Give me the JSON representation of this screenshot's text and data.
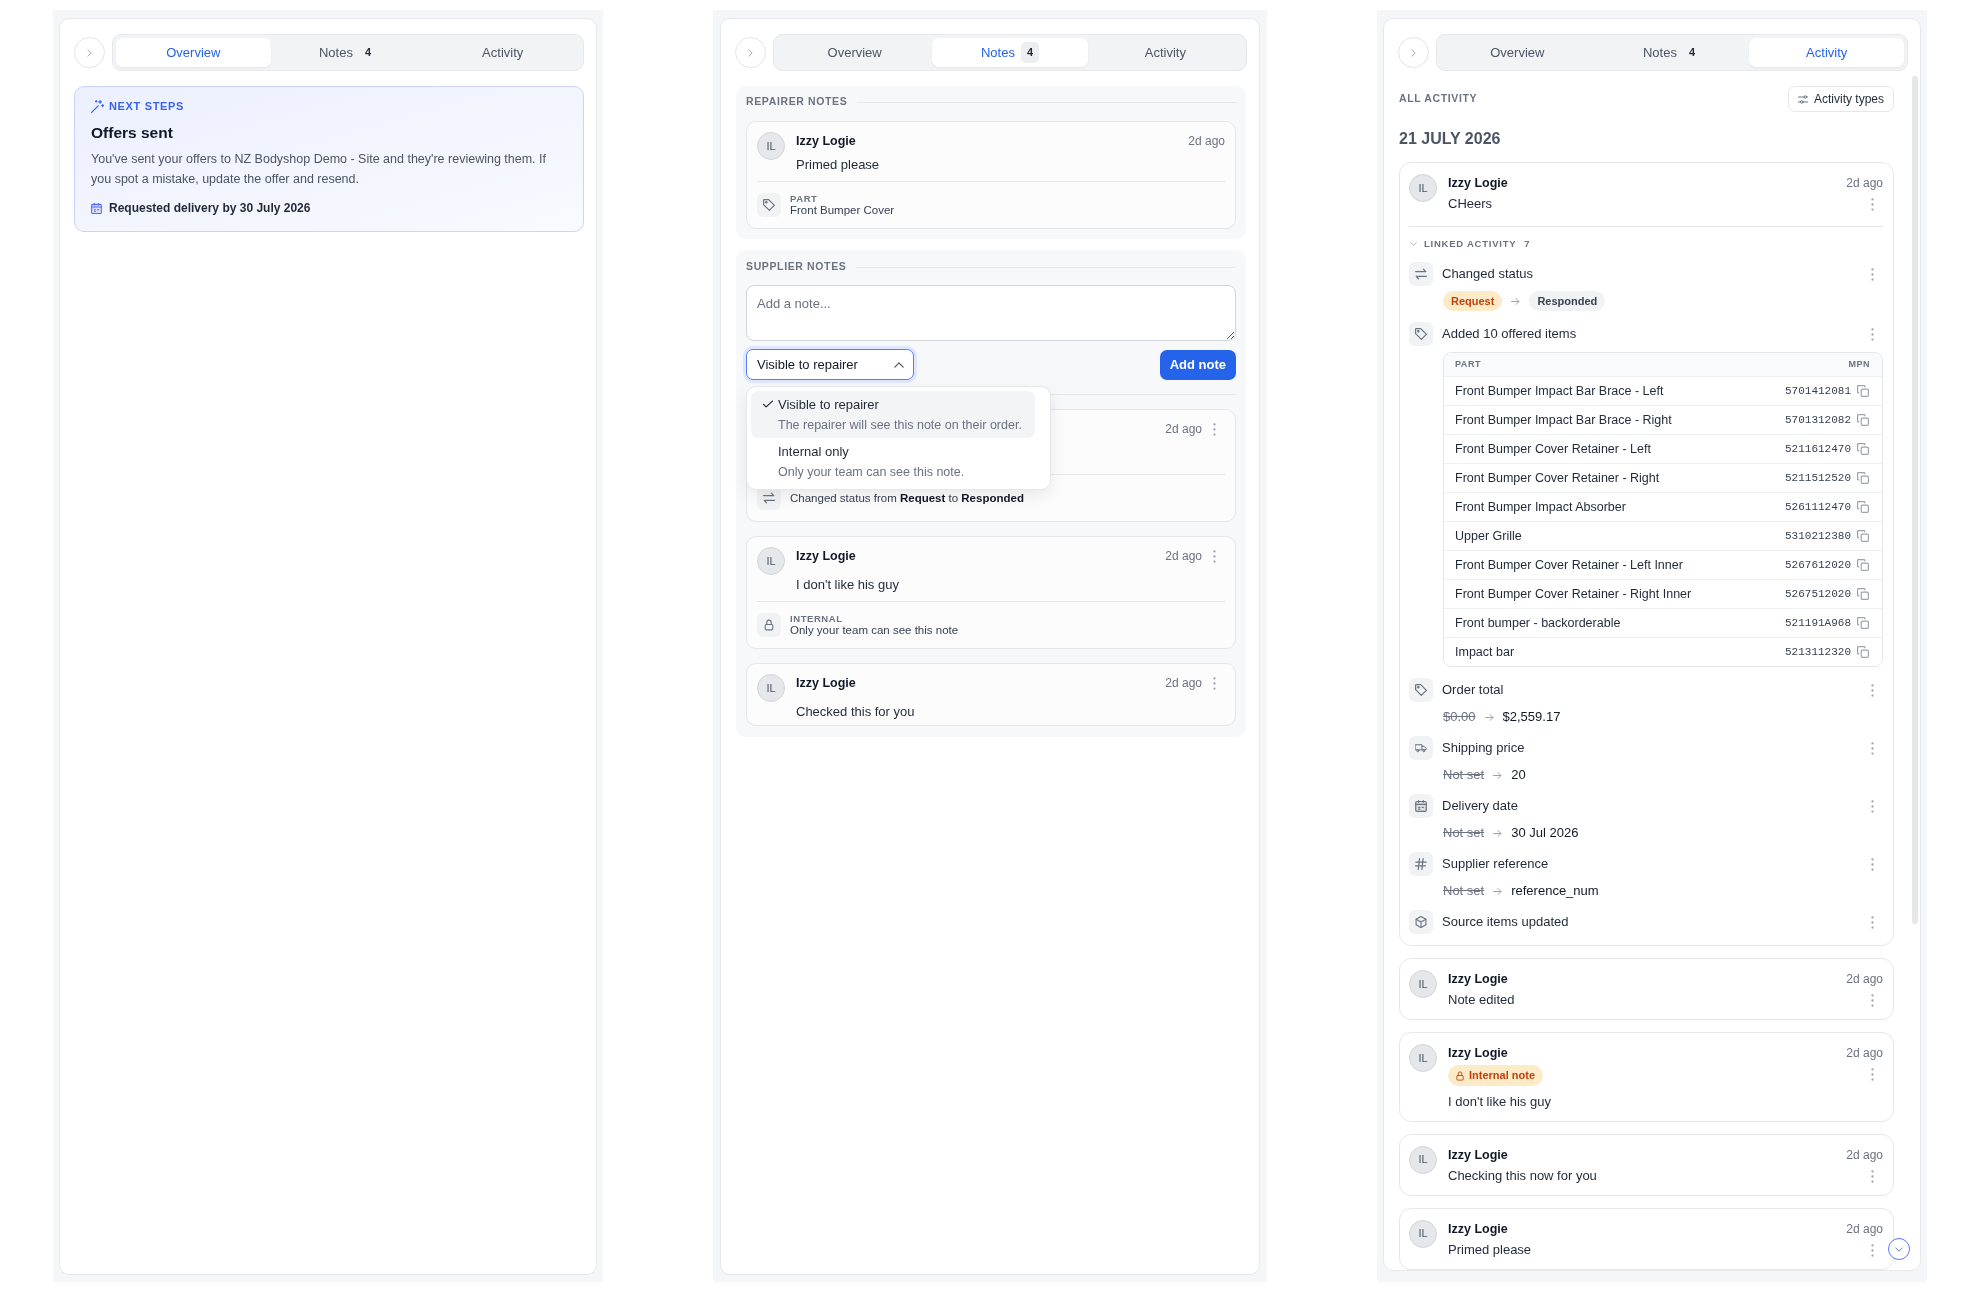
{
  "panels": [
    {
      "kind": "overview",
      "tabs": [
        {
          "label": "Overview",
          "selected": true
        },
        {
          "label": "Notes",
          "count": "4",
          "selected": false
        },
        {
          "label": "Activity",
          "selected": false
        }
      ],
      "next_steps": {
        "label": "NEXT STEPS",
        "title": "Offers sent",
        "text": "You've sent your offers to NZ Bodyshop Demo - Site and they're reviewing them. If you spot a mistake, update the offer and resend.",
        "delivery": "Requested delivery by 30 July 2026"
      }
    },
    {
      "kind": "notes",
      "tabs": [
        {
          "label": "Overview",
          "selected": false
        },
        {
          "label": "Notes",
          "count": "4",
          "selected": true
        },
        {
          "label": "Activity",
          "selected": false
        }
      ],
      "repairer_notes": {
        "heading": "REPAIRER NOTES",
        "notes": [
          {
            "initials": "IL",
            "author": "Izzy Logie",
            "time": "2d ago",
            "text": "Primed please",
            "footer": {
              "kind": "part",
              "label": "PART",
              "text": "Front Bumper Cover"
            }
          }
        ]
      },
      "supplier_notes": {
        "heading": "SUPPLIER NOTES",
        "placeholder": "Add a note...",
        "visibility": {
          "value": "Visible to repairer",
          "expanded": true,
          "options": [
            {
              "label": "Visible to repairer",
              "description": "The repairer will see this note on their order.",
              "selected": true
            },
            {
              "label": "Internal only",
              "description": "Only your team can see this note.",
              "selected": false
            }
          ]
        },
        "add_button": "Add note",
        "notes": [
          {
            "time": "2d ago",
            "footer": {
              "kind": "status",
              "text": "Changed status from **Request** to **Responded**"
            }
          },
          {
            "initials": "IL",
            "author": "Izzy Logie",
            "time": "2d ago",
            "text": "I don't like his guy",
            "footer": {
              "kind": "internal",
              "label": "INTERNAL",
              "text": "Only your team can see this note"
            }
          },
          {
            "initials": "IL",
            "author": "Izzy Logie",
            "time": "2d ago",
            "text": "Checked this for you"
          }
        ]
      }
    },
    {
      "kind": "activity",
      "tabs": [
        {
          "label": "Overview",
          "selected": false
        },
        {
          "label": "Notes",
          "count": "4",
          "selected": false
        },
        {
          "label": "Activity",
          "selected": true
        }
      ],
      "heading": "ALL ACTIVITY",
      "filter_button": "Activity types",
      "date": "21 JULY 2026",
      "entries": [
        {
          "initials": "IL",
          "author": "Izzy Logie",
          "time": "2d ago",
          "text": "CHeers",
          "linked": {
            "label": "LINKED ACTIVITY",
            "count": "7",
            "expanded": true,
            "items": [
              {
                "kind": "status",
                "title": "Changed status",
                "from": "Request",
                "to": "Responded"
              },
              {
                "kind": "items",
                "title": "Added 10 offered items",
                "table": {
                  "columns": [
                    "PART",
                    "MPN"
                  ],
                  "rows": [
                    [
                      "Front Bumper Impact Bar Brace - Left",
                      "5701412081"
                    ],
                    [
                      "Front Bumper Impact Bar Brace - Right",
                      "5701312082"
                    ],
                    [
                      "Front Bumper Cover Retainer - Left",
                      "5211612470"
                    ],
                    [
                      "Front Bumper Cover Retainer - Right",
                      "5211512520"
                    ],
                    [
                      "Front Bumper Impact Absorber",
                      "5261112470"
                    ],
                    [
                      "Upper Grille",
                      "5310212380"
                    ],
                    [
                      "Front Bumper Cover Retainer - Left Inner",
                      "5267612020"
                    ],
                    [
                      "Front Bumper Cover Retainer - Right Inner",
                      "5267512020"
                    ],
                    [
                      "Front bumper - backorderable",
                      "521191A968"
                    ],
                    [
                      "Impact bar",
                      "5213112320"
                    ]
                  ]
                }
              },
              {
                "kind": "total",
                "title": "Order total",
                "from": "$0.00",
                "to": "$2,559.17"
              },
              {
                "kind": "shipping",
                "title": "Shipping price",
                "from": "Not set",
                "to": "20"
              },
              {
                "kind": "delivery",
                "title": "Delivery date",
                "from": "Not set",
                "to": "30 Jul 2026"
              },
              {
                "kind": "reference",
                "title": "Supplier reference",
                "from": "Not set",
                "to": "reference_num"
              },
              {
                "kind": "source",
                "title": "Source items updated"
              }
            ]
          }
        },
        {
          "initials": "IL",
          "author": "Izzy Logie",
          "time": "2d ago",
          "text": "Note edited"
        },
        {
          "initials": "IL",
          "author": "Izzy Logie",
          "time": "2d ago",
          "tag": "Internal note",
          "text": "I don't like his guy"
        },
        {
          "initials": "IL",
          "author": "Izzy Logie",
          "time": "2d ago",
          "text": "Checking this now for you"
        },
        {
          "initials": "IL",
          "author": "Izzy Logie",
          "time": "2d ago",
          "text": "Primed please"
        }
      ]
    }
  ]
}
